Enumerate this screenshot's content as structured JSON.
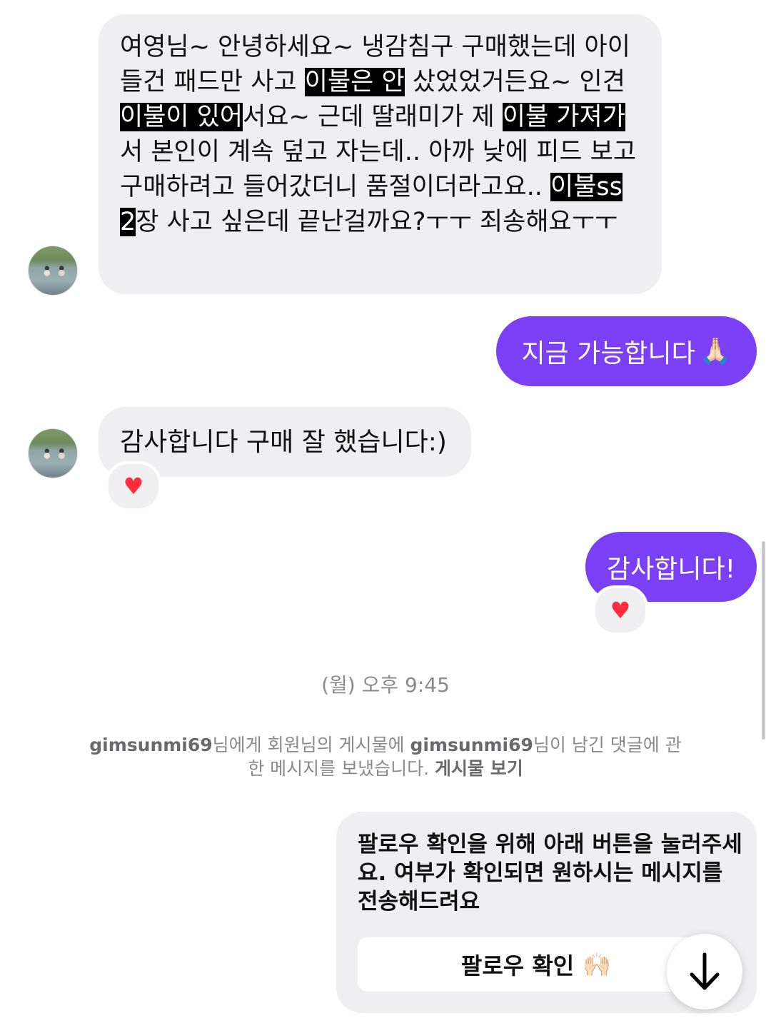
{
  "messages": {
    "incoming_1": {
      "segments": [
        {
          "text": "여영님~ 안녕하세요~ 냉감침구 구매했는데 아이들건 패드만 사고 ",
          "hl": false
        },
        {
          "text": "이불은 안",
          "hl": true
        },
        {
          "text": " 샀었었거든요~ 인견",
          "hl": false
        },
        {
          "text": "이불이 있어",
          "hl": true
        },
        {
          "text": "서요~ 근데 딸래미가 제 ",
          "hl": false
        },
        {
          "text": "이불 가져가",
          "hl": true
        },
        {
          "text": "서 본인이 계속 덮고 자는데.. 아까 낮에 피드 보고 구매하려고 들어갔더니 품절이더라고요.. ",
          "hl": false
        },
        {
          "text": "이불ss 2",
          "hl": true
        },
        {
          "text": "장 사고 싶은데 끝난걸까요?ㅜㅜ 죄송해요ㅜㅜ",
          "hl": false
        }
      ]
    },
    "outgoing_1": {
      "text": "지금 가능합니다",
      "emoji": "🙏🏻"
    },
    "incoming_2": {
      "text": "감사합니다 구매 잘 했습니다:)",
      "reaction": "♥"
    },
    "outgoing_2": {
      "text": "감사합니다!",
      "reaction": "♥"
    }
  },
  "timestamp": "(월) 오후 9:45",
  "system_message": {
    "user1": "gimsunmi69",
    "part1": "님에게 회원님의 게시물에 ",
    "user2": "gimsunmi69",
    "part2": "님이 남긴 댓글에 관한 메시지를 보냈습니다. ",
    "link": "게시물 보기"
  },
  "card": {
    "text": "팔로우 확인을 위해 아래 버튼을 눌러주세요. 여부가 확인되면 원하시는 메시지를 전송해드려요",
    "button_label": "팔로우 확인",
    "button_emoji": "🙌🏻"
  },
  "icons": {
    "scroll_down": "arrow-down-icon",
    "reaction": "heart-icon"
  },
  "colors": {
    "outgoing_bubble": "#7b3ff5",
    "incoming_bubble": "#efeff1",
    "heart": "#ff2d3b",
    "system_text": "#8a8a8e"
  }
}
